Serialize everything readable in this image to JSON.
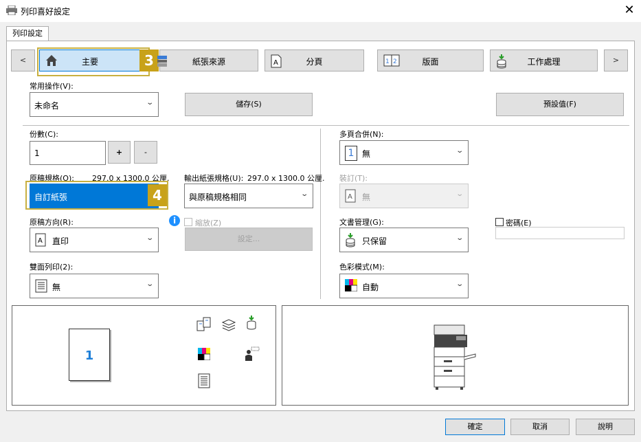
{
  "window": {
    "title": "列印喜好設定",
    "close": "✕"
  },
  "tabs": [
    {
      "label": "列印設定"
    }
  ],
  "nav": {
    "prev": "<",
    "next": ">",
    "items": [
      {
        "label": "主要",
        "icon": "home-icon"
      },
      {
        "label": "紙張來源",
        "icon": "paper-tray-icon"
      },
      {
        "label": "分頁",
        "icon": "tab-page-icon"
      },
      {
        "label": "版面",
        "icon": "layout-icon"
      },
      {
        "label": "工作處理",
        "icon": "job-handling-icon"
      }
    ]
  },
  "badges": {
    "main_tab": "3",
    "original_size": "4"
  },
  "common": {
    "label": "常用操作(V):",
    "value": "未命名",
    "save": "儲存(S)",
    "defaults": "預設值(F)"
  },
  "copies": {
    "label": "份數(C):",
    "value": "1",
    "plus": "+",
    "minus": "-"
  },
  "original_size": {
    "label": "原稿規格(O):",
    "dims": "297.0 x 1300.0 公厘.",
    "value": "自訂紙張"
  },
  "output_size": {
    "label": "輸出紙張規格(U):",
    "dims": "297.0 x 1300.0 公厘.",
    "value": "與原稿規格相同"
  },
  "orientation": {
    "label": "原稿方向(R):",
    "value": "直印"
  },
  "zoom": {
    "label": "縮放(Z)",
    "settings": "設定..."
  },
  "duplex": {
    "label": "雙面列印(2):",
    "value": "無"
  },
  "nup": {
    "label": "多頁合併(N):",
    "value": "無",
    "icon_text": "1"
  },
  "staple": {
    "label": "裝訂(T):",
    "value": "無"
  },
  "retention": {
    "label": "文書管理(G):",
    "value": "只保留"
  },
  "password": {
    "label": "密碼(E)"
  },
  "color": {
    "label": "色彩模式(M):",
    "value": "自動"
  },
  "preview": {
    "page_number": "1"
  },
  "footer": {
    "ok": "確定",
    "cancel": "取消",
    "help": "說明"
  },
  "colors": {
    "accent": "#0078d7",
    "highlight_border": "#c8b040",
    "badge": "#c8a21a",
    "info": "#1e90ff"
  }
}
